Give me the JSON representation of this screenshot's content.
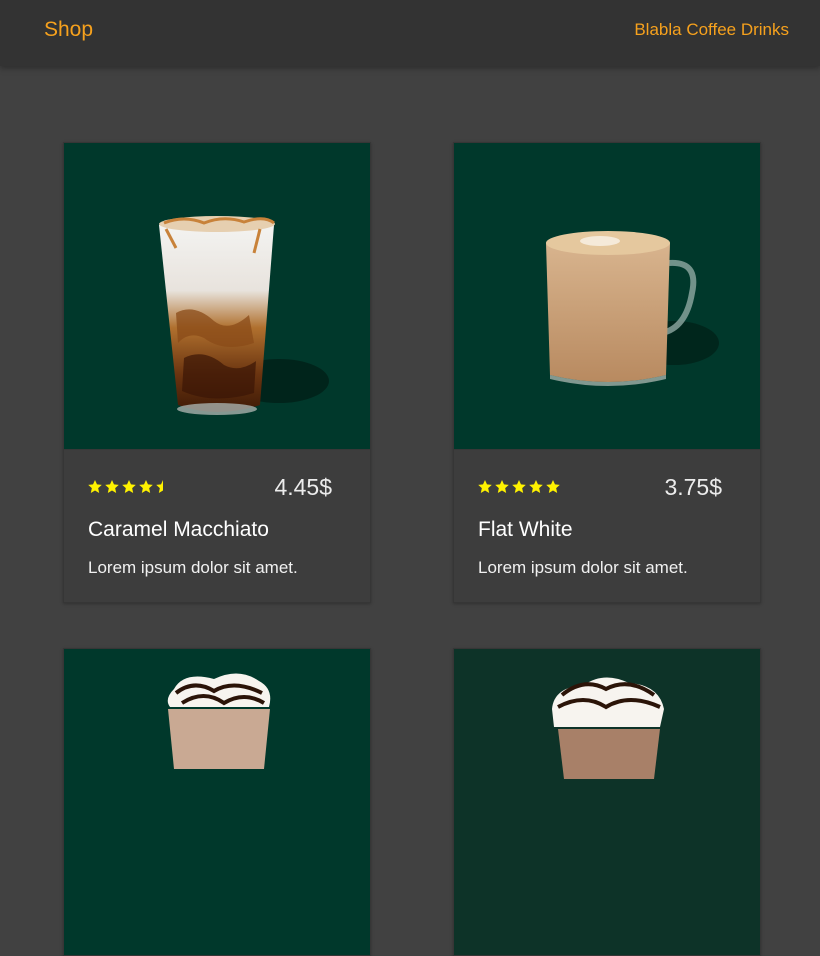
{
  "header": {
    "brand": "Shop",
    "nav_link": "Blabla Coffee Drinks"
  },
  "colors": {
    "accent": "#f6a11d",
    "page_bg": "#414141",
    "header_bg": "#333333",
    "card_image_bg": "#00382b",
    "star": "#fff200"
  },
  "products": [
    {
      "name": "Caramel Macchiato",
      "price": "4.45$",
      "rating": 4.5,
      "description": "Lorem ipsum dolor sit amet."
    },
    {
      "name": "Flat White",
      "price": "3.75$",
      "rating": 5,
      "description": "Lorem ipsum dolor sit amet."
    },
    {
      "name": "",
      "price": "",
      "rating": null,
      "description": ""
    },
    {
      "name": "",
      "price": "",
      "rating": null,
      "description": ""
    }
  ]
}
